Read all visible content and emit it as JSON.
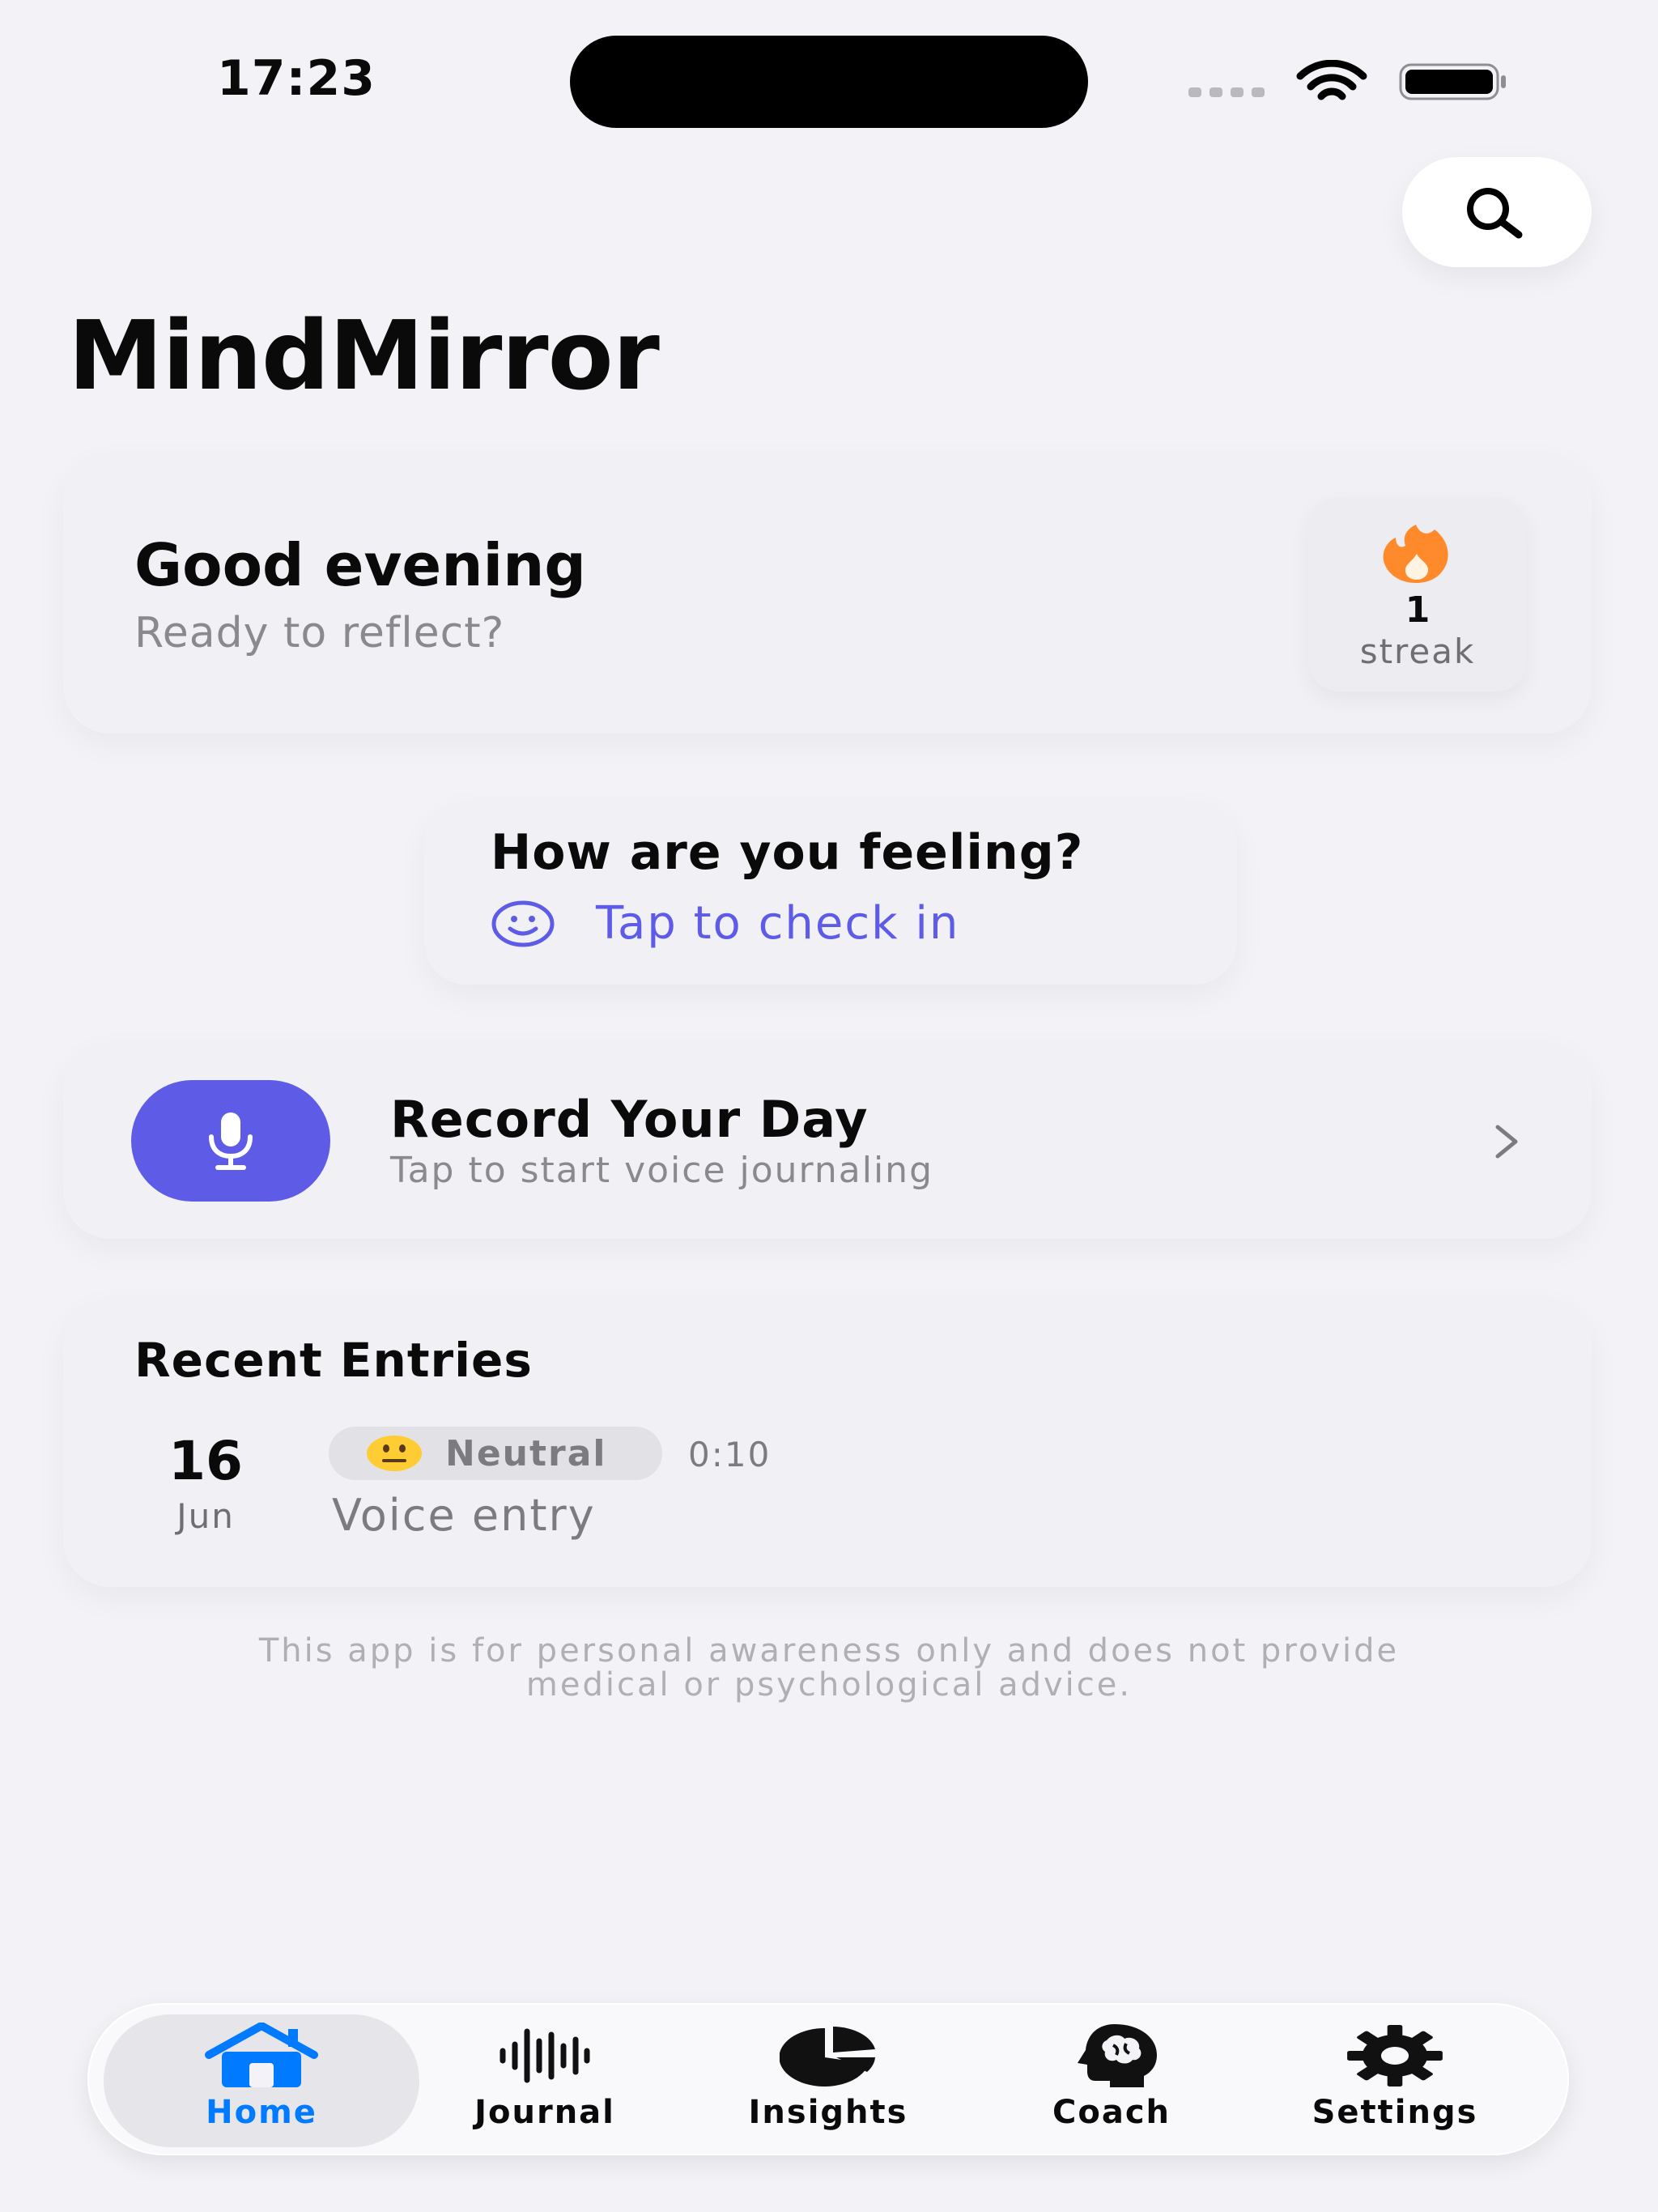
{
  "status_bar": {
    "time": "17:23"
  },
  "app": {
    "title": "MindMirror"
  },
  "greeting": {
    "title": "Good evening",
    "subtitle": "Ready to reflect?",
    "streak_count": "1",
    "streak_label": "streak",
    "streak_icon": "flame-icon"
  },
  "mood_check": {
    "title": "How are you feeling?",
    "cta": "Tap to check in",
    "icon": "smiley-icon"
  },
  "record": {
    "title": "Record Your Day",
    "subtitle": "Tap to start voice journaling",
    "icon": "microphone-icon"
  },
  "recent": {
    "title": "Recent Entries",
    "entries": [
      {
        "day": "16",
        "month": "Jun",
        "mood": "Neutral",
        "mood_icon": "neutral-face-icon",
        "duration": "0:10",
        "type": "Voice entry"
      }
    ]
  },
  "disclaimer": {
    "line1": "This app is for personal awareness only and does not provide",
    "line2": "medical or psychological advice."
  },
  "tabbar": {
    "selected": "Home",
    "tabs": [
      {
        "label": "Home",
        "icon": "house-icon"
      },
      {
        "label": "Journal",
        "icon": "waveform-icon"
      },
      {
        "label": "Insights",
        "icon": "pie-chart-icon"
      },
      {
        "label": "Coach",
        "icon": "brain-head-icon"
      },
      {
        "label": "Settings",
        "icon": "gear-icon"
      }
    ]
  },
  "colors": {
    "background": "#f2f2f7",
    "accent": "#5e5ce6",
    "tab_active": "#007aff",
    "streak_flame": "#ff8a2b"
  }
}
